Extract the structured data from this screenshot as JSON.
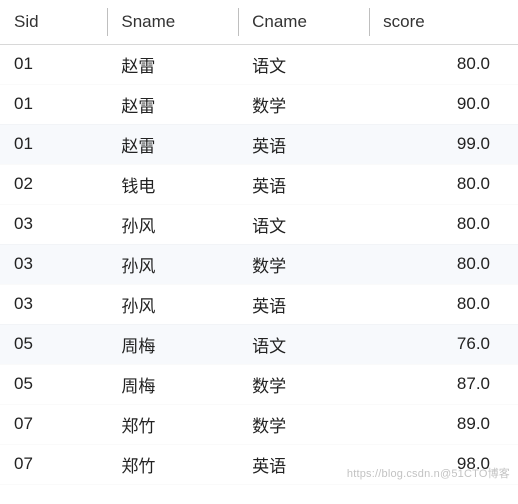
{
  "columns": [
    {
      "key": "sid",
      "label": "Sid"
    },
    {
      "key": "sname",
      "label": "Sname"
    },
    {
      "key": "cname",
      "label": "Cname"
    },
    {
      "key": "score",
      "label": "score"
    }
  ],
  "rows": [
    {
      "sid": "01",
      "sname": "赵雷",
      "cname": "语文",
      "score": "80.0"
    },
    {
      "sid": "01",
      "sname": "赵雷",
      "cname": "数学",
      "score": "90.0"
    },
    {
      "sid": "01",
      "sname": "赵雷",
      "cname": "英语",
      "score": "99.0"
    },
    {
      "sid": "02",
      "sname": "钱电",
      "cname": "英语",
      "score": "80.0"
    },
    {
      "sid": "03",
      "sname": "孙风",
      "cname": "语文",
      "score": "80.0"
    },
    {
      "sid": "03",
      "sname": "孙风",
      "cname": "数学",
      "score": "80.0"
    },
    {
      "sid": "03",
      "sname": "孙风",
      "cname": "英语",
      "score": "80.0"
    },
    {
      "sid": "05",
      "sname": "周梅",
      "cname": "语文",
      "score": "76.0"
    },
    {
      "sid": "05",
      "sname": "周梅",
      "cname": "数学",
      "score": "87.0"
    },
    {
      "sid": "07",
      "sname": "郑竹",
      "cname": "数学",
      "score": "89.0"
    },
    {
      "sid": "07",
      "sname": "郑竹",
      "cname": "英语",
      "score": "98.0"
    }
  ],
  "alt_rows": [
    2,
    5,
    7
  ],
  "watermark": "https://blog.csdn.n@51CTO博客"
}
